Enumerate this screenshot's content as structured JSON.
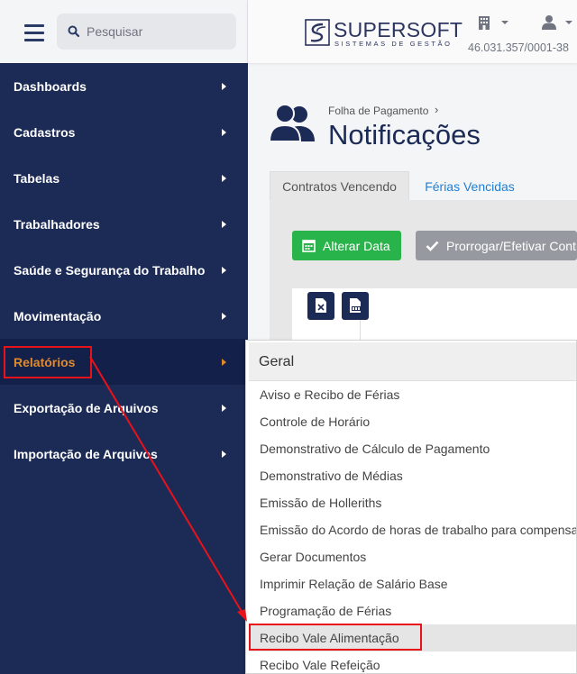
{
  "search": {
    "placeholder": "Pesquisar"
  },
  "sidebar": {
    "items": [
      {
        "label": "Dashboards"
      },
      {
        "label": "Cadastros"
      },
      {
        "label": "Tabelas"
      },
      {
        "label": "Trabalhadores"
      },
      {
        "label": "Saúde e Segurança do Trabalho"
      },
      {
        "label": "Movimentação"
      },
      {
        "label": "Relatórios",
        "active": true
      },
      {
        "label": "Exportação de Arquivos"
      },
      {
        "label": "Importação de Arquivos"
      }
    ]
  },
  "header": {
    "brand_name": "SUPERSOFT",
    "brand_tagline": "SISTEMAS DE GESTÃO",
    "cnpj": "46.031.357/0001-38"
  },
  "page": {
    "breadcrumb": "Folha de Pagamento",
    "breadcrumb_separator": "›",
    "title": "Notificações"
  },
  "tabs": [
    {
      "label": "Contratos Vencendo",
      "active": true
    },
    {
      "label": "Férias Vencidas",
      "active": false
    }
  ],
  "actions": {
    "change_date": "Alterar Data",
    "extend": "Prorrogar/Efetivar Contrato"
  },
  "reports_menu": {
    "group": "Geral",
    "items": [
      {
        "label": "Aviso e Recibo de Férias"
      },
      {
        "label": "Controle de Horário"
      },
      {
        "label": "Demonstrativo de Cálculo de Pagamento"
      },
      {
        "label": "Demonstrativo de Médias"
      },
      {
        "label": "Emissão de Holleriths"
      },
      {
        "label": "Emissão do Acordo de horas de trabalho para compensação"
      },
      {
        "label": "Gerar Documentos"
      },
      {
        "label": "Imprimir Relação de Salário Base"
      },
      {
        "label": "Programação de Férias"
      },
      {
        "label": "Recibo Vale Alimentação",
        "highlighted": true
      },
      {
        "label": "Recibo Vale Refeição"
      }
    ]
  },
  "colors": {
    "sidebar_bg": "#1c2b56",
    "active_item_text": "#e08a2c",
    "primary_green": "#28b44a",
    "link_blue": "#1e7fd6",
    "annotation_red": "#e8121a"
  }
}
